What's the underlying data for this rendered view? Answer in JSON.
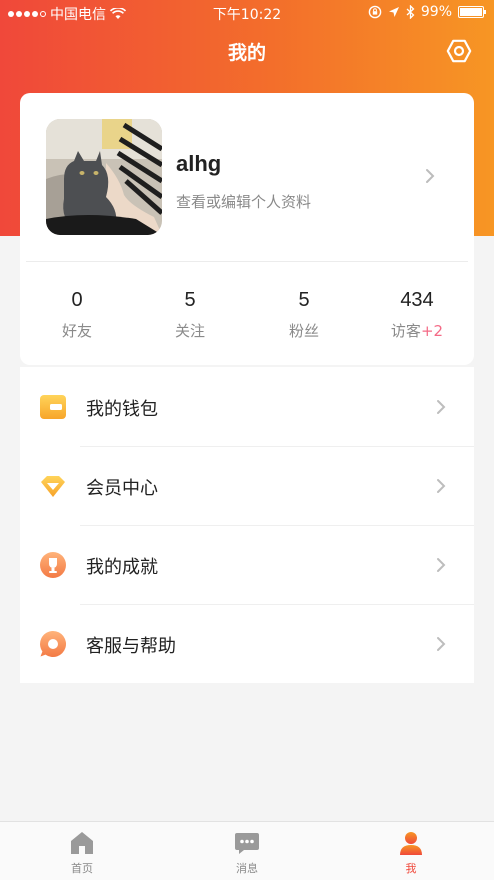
{
  "status_bar": {
    "carrier": "中国电信",
    "time": "下午10:22",
    "battery_text": "99%",
    "battery_level": 0.99
  },
  "nav": {
    "title": "我的",
    "settings_icon": "settings-hexagon-icon"
  },
  "profile": {
    "username": "alhg",
    "subtitle": "查看或编辑个人资料"
  },
  "stats": [
    {
      "value": "0",
      "label": "好友"
    },
    {
      "value": "5",
      "label": "关注"
    },
    {
      "value": "5",
      "label": "粉丝"
    },
    {
      "value": "434",
      "label": "访客",
      "badge": "+2"
    }
  ],
  "menu": [
    {
      "label": "我的钱包",
      "icon": "wallet-icon"
    },
    {
      "label": "会员中心",
      "icon": "diamond-icon"
    },
    {
      "label": "我的成就",
      "icon": "trophy-icon"
    },
    {
      "label": "客服与帮助",
      "icon": "chat-bubble-icon"
    }
  ],
  "tabs": [
    {
      "label": "首页",
      "icon": "home-icon",
      "active": false
    },
    {
      "label": "消息",
      "icon": "message-icon",
      "active": false
    },
    {
      "label": "我",
      "icon": "user-icon",
      "active": true
    }
  ],
  "colors": {
    "header_gradient_start": "#f0483a",
    "header_gradient_end": "#f79624",
    "accent": "#f0483a",
    "badge_pink": "#f46a86"
  }
}
